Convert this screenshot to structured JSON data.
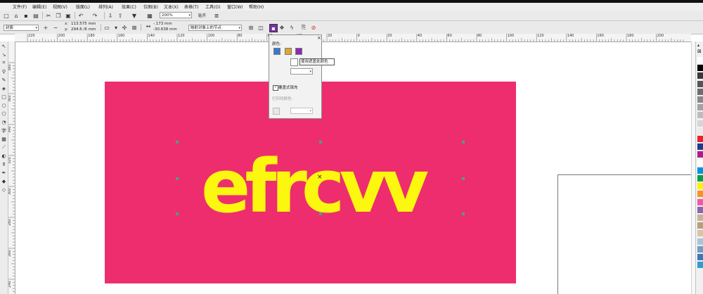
{
  "menu": [
    "文件(F)",
    "编辑(E)",
    "视图(V)",
    "版面(L)",
    "排列(A)",
    "效果(C)",
    "位图(B)",
    "文本(X)",
    "表格(T)",
    "工具(O)",
    "窗口(W)",
    "帮助(H)"
  ],
  "toolbar": {
    "zoom": "200%",
    "snap_label": "贴齐"
  },
  "property_bar": {
    "object_type": "封套",
    "x_label": "x:",
    "x_value": "113.575 mm",
    "y_label": "y:",
    "y_value": "294.6 /6 mm",
    "dx_value": "-.173 mm",
    "dy_value": "-30.638 mm",
    "node_mode": "映射对象上的节点"
  },
  "ruler": {
    "h_labels": [
      "220",
      "200",
      "180",
      "160",
      "140",
      "120",
      "100",
      "80",
      "60",
      "40",
      "20",
      "0",
      "20",
      "40",
      "60",
      "80",
      "100",
      "120",
      "140",
      "160",
      "180",
      "200"
    ],
    "v_labels": [
      "380",
      "360",
      "340",
      "320",
      "300",
      "280",
      "260",
      "240"
    ]
  },
  "artwork": {
    "text": "efrcvv",
    "background_color": "#ee2d6e",
    "text_color": "#fbf70f"
  },
  "popup": {
    "color_section": "颜色:",
    "tooltip": "使用遮盖处颜色",
    "overprint_checkbox": "覆盖式填充",
    "overprint_color_label": "打印的颜色:"
  },
  "palette": {
    "colors": [
      "#ffffff",
      "#000000",
      "#3a3a3a",
      "#555555",
      "#6e6e6e",
      "#8a8a8a",
      "#a3a3a3",
      "#bdbdbd",
      "#d6d6d6",
      "#ebebeb",
      "#e6242c",
      "#1e3b8f",
      "#b01b8a",
      "#ffffff",
      "#0095d9",
      "#00a04a",
      "#fff200",
      "#f7941d",
      "#ef5aa0",
      "#8a66b0",
      "#c7b39b",
      "#b5a07c",
      "#d6c6a8",
      "#a8c6d9",
      "#6f9fc2",
      "#3b78b8",
      "#2e9dd1"
    ]
  }
}
